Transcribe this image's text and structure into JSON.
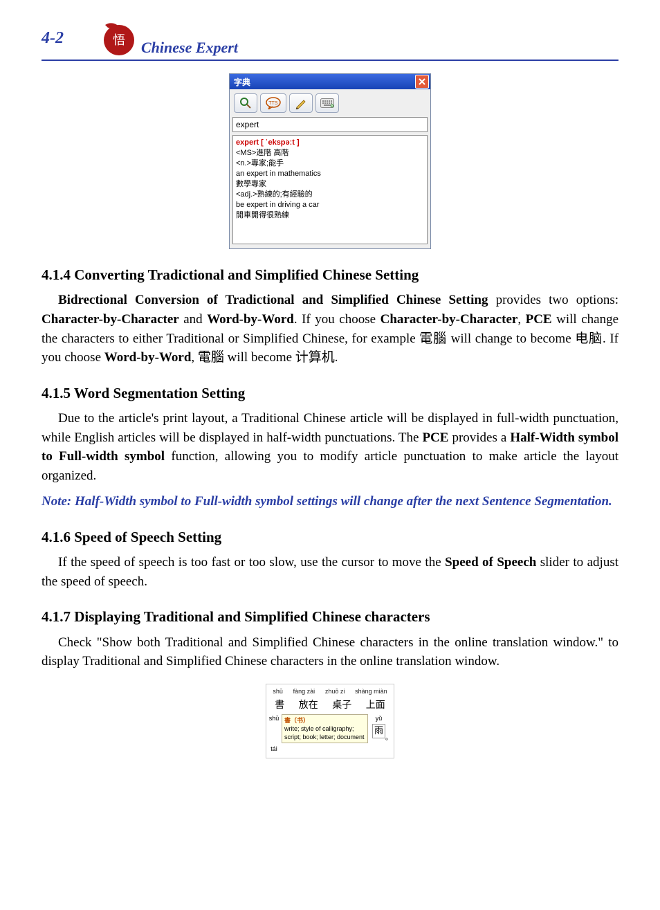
{
  "header": {
    "page_number": "4-2",
    "brand": "Chinese Expert"
  },
  "dictionary_window": {
    "title": "字典",
    "search_value": "expert",
    "result": {
      "headword": "expert [ ˈekspəːt ]",
      "lines": [
        "<MS>進階 高階",
        "<n.>專家;能手",
        "an expert in mathematics",
        "數學專家",
        "<adj.>熟練的;有經驗的",
        "be expert in driving a car",
        "開車開得很熟練"
      ]
    }
  },
  "sections": {
    "s414": {
      "heading": "4.1.4  Converting Tradictional and Simplified Chinese Setting",
      "para_parts": {
        "p1": "Bidrectional Conversion of Tradictional and Simplified Chinese Setting",
        "p2": " provides two options: ",
        "p3": "Character-by-Character",
        "p4": " and ",
        "p5": "Word-by-Word",
        "p6": ". If you choose ",
        "p7": "Character-by-Character",
        "p8": ", ",
        "p9": "PCE",
        "p10": " will change the characters to either Traditional or Simplified Chinese, for example 電腦 will change to become 电脑. If you choose ",
        "p11": "Word-by-Word",
        "p12": ", 電腦 will become 计算机."
      }
    },
    "s415": {
      "heading": "4.1.5  Word Segmentation Setting",
      "para_parts": {
        "p1": "Due to the article's print layout, a Traditional Chinese article will be displayed in full-width punctuation, while English articles will be displayed in half-width punctuations. The ",
        "p2": "PCE",
        "p3": " provides a ",
        "p4": "Half-Width symbol to Full-width symbol",
        "p5": " function, allowing you to modify article punctuation to make article the layout organized."
      },
      "note": "Note: Half-Width symbol to Full-width symbol settings will change after the next Sentence Segmentation."
    },
    "s416": {
      "heading": "4.1.6  Speed of Speech Setting",
      "para_parts": {
        "p1": "If the speed of speech is too fast or too slow, use the cursor to move the ",
        "p2": "Speed of Speech",
        "p3": " slider to adjust the speed of speech."
      }
    },
    "s417": {
      "heading": "4.1.7  Displaying Traditional and Simplified Chinese characters",
      "para": "Check \"Show both Traditional and Simplified Chinese characters in the online translation window.\" to display Traditional and Simplified Chinese characters in the online translation window."
    }
  },
  "figure2": {
    "pinyin": [
      "shū",
      "fàng zài",
      "zhuō zi",
      "shàng miàn"
    ],
    "hanzi": [
      "書",
      "放在",
      "桌子",
      "上面"
    ],
    "left_p1": "shū",
    "left_p2": "tái",
    "tooltip_head": "書（书）",
    "tooltip_body": "write; style of calligraphy; script; book; letter; document",
    "right_p": "yǔ",
    "right_c": "雨",
    "circle": "。"
  }
}
